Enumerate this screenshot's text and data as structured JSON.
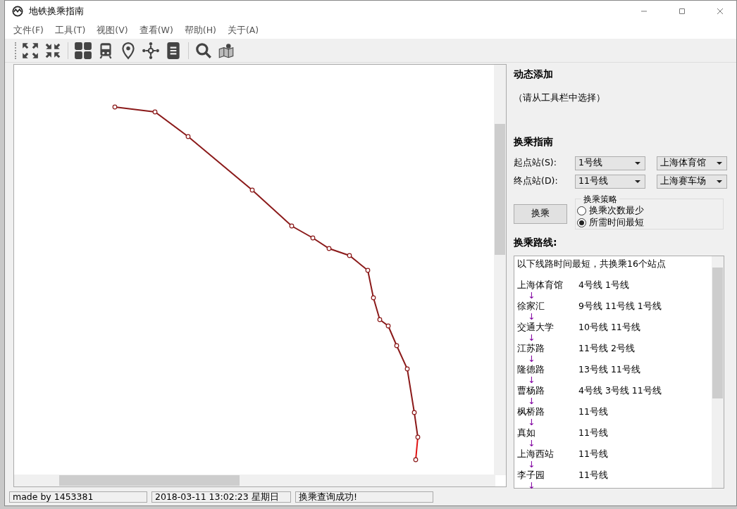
{
  "window": {
    "title": "地铁换乘指南"
  },
  "menu": [
    "文件(F)",
    "工具(T)",
    "视图(V)",
    "查看(W)",
    "帮助(H)",
    "关于(A)"
  ],
  "dynamic_add": {
    "heading": "动态添加",
    "hint": "（请从工具栏中选择）"
  },
  "transfer_guide": {
    "heading": "换乘指南",
    "start": {
      "label": "起点站(S):",
      "line": "1号线",
      "station": "上海体育馆"
    },
    "end": {
      "label": "终点站(D):",
      "line": "11号线",
      "station": "上海赛车场"
    },
    "button": "换乘",
    "strategy": {
      "title": "换乘策略",
      "options": [
        {
          "label": "换乘次数最少",
          "selected": false
        },
        {
          "label": "所需时间最短",
          "selected": true
        }
      ]
    }
  },
  "route": {
    "heading": "换乘路线:",
    "summary": "以下线路时间最短，共换乘16个站点",
    "steps": [
      {
        "kind": "station",
        "station": "上海体育馆",
        "lines": "4号线 1号线"
      },
      {
        "kind": "arrow",
        "text": "↓"
      },
      {
        "kind": "station",
        "station": "徐家汇",
        "lines": "9号线 11号线 1号线"
      },
      {
        "kind": "arrow",
        "text": "↓"
      },
      {
        "kind": "station",
        "station": "交通大学",
        "lines": "10号线 11号线"
      },
      {
        "kind": "arrow",
        "text": "↓"
      },
      {
        "kind": "station",
        "station": "江苏路",
        "lines": "11号线 2号线"
      },
      {
        "kind": "arrow",
        "text": "↓"
      },
      {
        "kind": "station",
        "station": "隆德路",
        "lines": "13号线 11号线"
      },
      {
        "kind": "arrow",
        "text": "↓"
      },
      {
        "kind": "station",
        "station": "曹杨路",
        "lines": "4号线 3号线 11号线"
      },
      {
        "kind": "arrow",
        "text": "↓"
      },
      {
        "kind": "station",
        "station": "枫桥路",
        "lines": "11号线"
      },
      {
        "kind": "arrow",
        "text": "↓"
      },
      {
        "kind": "station",
        "station": "真如",
        "lines": "11号线"
      },
      {
        "kind": "arrow",
        "text": "↓"
      },
      {
        "kind": "station",
        "station": "上海西站",
        "lines": "11号线"
      },
      {
        "kind": "arrow",
        "text": "↓"
      },
      {
        "kind": "station",
        "station": "李子园",
        "lines": "11号线"
      },
      {
        "kind": "arrow",
        "text": "↓"
      }
    ]
  },
  "status_bar": [
    "made by 1453381",
    "2018-03-11 13:02:23 星期日",
    "换乘查询成功!"
  ]
}
